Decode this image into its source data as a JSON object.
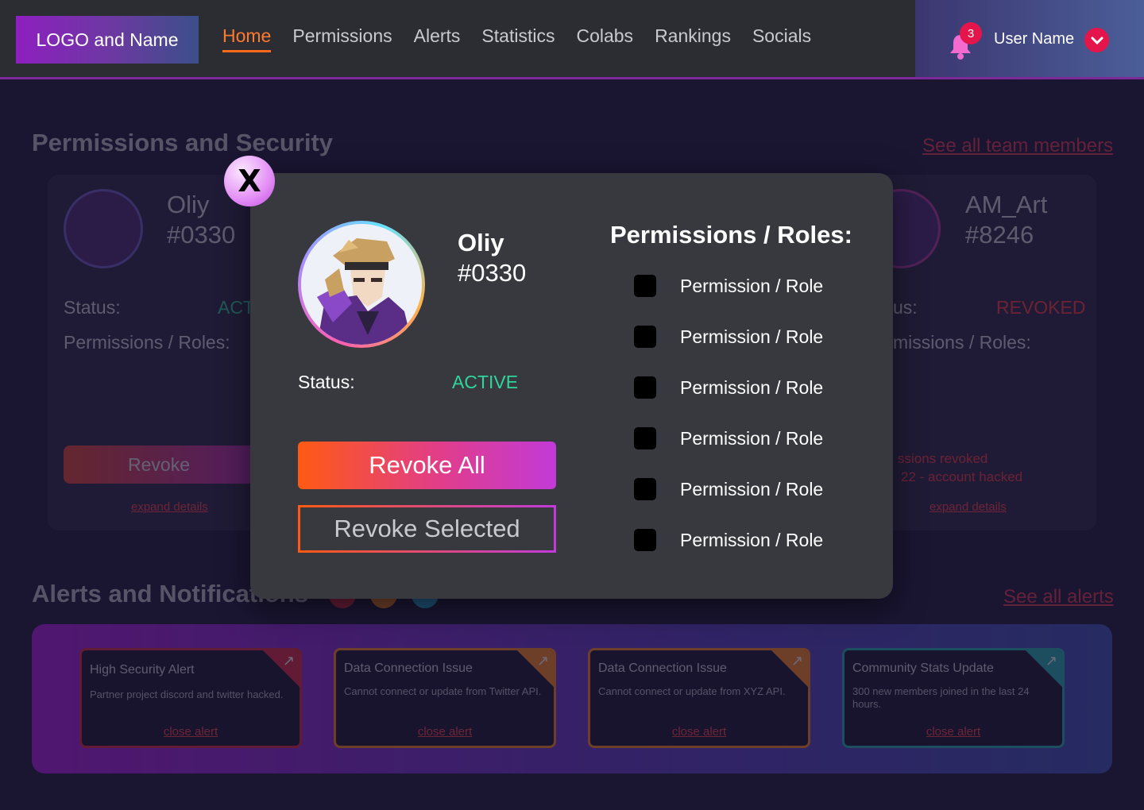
{
  "header": {
    "logo": "LOGO and Name",
    "nav": [
      "Home",
      "Permissions",
      "Alerts",
      "Statistics",
      "Colabs",
      "Rankings",
      "Socials"
    ],
    "active_nav": "Home",
    "notification_count": "3",
    "user_name": "User Name"
  },
  "permissions_section": {
    "title": "Permissions and Security",
    "see_all": "See all team members",
    "left_card": {
      "name": "Oliy",
      "tag": "#0330",
      "status_label": "Status:",
      "status_value": "ACT",
      "roles_label": "Permissions / Roles:",
      "revoke": "Revoke",
      "expand": "expand details"
    },
    "right_card": {
      "name": "AM_Art",
      "tag": "#8246",
      "status_label": "us:",
      "status_value": "REVOKED",
      "roles_label": "missions / Roles:",
      "note_line1": "ssions revoked",
      "note_line2": "22 - account hacked",
      "expand": "expand details"
    }
  },
  "alerts_section": {
    "title": "Alerts and Notifications",
    "see_all": "See all alerts",
    "cards": [
      {
        "title": "High Security Alert",
        "body": "Partner project discord and twitter hacked.",
        "close": "close alert",
        "color": "#e0283a"
      },
      {
        "title": "Data Connection Issue",
        "body": "Cannot connect or update from Twitter API.",
        "close": "close alert",
        "color": "#ff8a1a"
      },
      {
        "title": "Data Connection Issue",
        "body": "Cannot connect or update from XYZ API.",
        "close": "close alert",
        "color": "#ff8a1a"
      },
      {
        "title": "Community Stats Update",
        "body": "300 new members joined in the last 24 hours.",
        "close": "close alert",
        "color": "#23b3b0"
      }
    ]
  },
  "modal": {
    "close_label": "X",
    "user_name": "Oliy",
    "user_tag": "#0330",
    "status_label": "Status:",
    "status_value": "ACTIVE",
    "revoke_all": "Revoke All",
    "revoke_selected": "Revoke Selected",
    "permissions_title": "Permissions / Roles:",
    "permissions": [
      "Permission / Role",
      "Permission / Role",
      "Permission / Role",
      "Permission / Role",
      "Permission / Role",
      "Permission / Role"
    ]
  },
  "colors": {
    "accent_orange": "#ff6a1a",
    "active_green": "#2fd59a",
    "danger_red": "#e4154b",
    "modal_bg": "#38393e",
    "page_bg": "#1a1531"
  }
}
